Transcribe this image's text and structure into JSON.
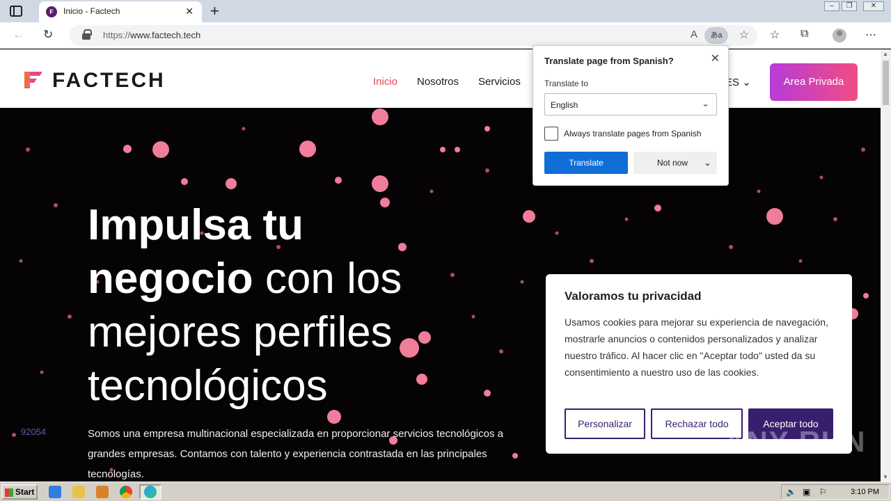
{
  "browser": {
    "tab_title": "Inicio - Factech",
    "url_scheme": "https://",
    "url_host": "www.factech.tech",
    "translate_btn_label": "あa"
  },
  "site": {
    "logo_text": "FACTECH",
    "menu": [
      "Inicio",
      "Nosotros",
      "Servicios"
    ],
    "lang": "ES",
    "area_button": "Area Privada",
    "hero_title_l1": "Impulsa tu",
    "hero_title_l2a": "negocio",
    "hero_title_l2b": " con los",
    "hero_title_l3": "mejores perfiles",
    "hero_title_l4": "tecnológicos",
    "hero_text": "Somos una empresa multinacional especializada en proporcionar servicios tecnológicos a grandes empresas. Contamos con talento y experiencia contrastada en las principales tecnologías.",
    "counter": "92054"
  },
  "cookie": {
    "title": "Valoramos tu privacidad",
    "body": "Usamos cookies para mejorar su experiencia de navegación, mostrarle anuncios o contenidos personalizados y analizar nuestro tráfico. Al hacer clic en \"Aceptar todo\" usted da su consentimiento a nuestro uso de las cookies.",
    "btn_customize": "Personalizar",
    "btn_reject": "Rechazar todo",
    "btn_accept": "Aceptar todo"
  },
  "translate": {
    "title": "Translate page from Spanish?",
    "label": "Translate to",
    "selected_language": "English",
    "always_label": "Always translate pages from Spanish",
    "translate_button": "Translate",
    "not_now_button": "Not now"
  },
  "watermark": "ANY RUN",
  "taskbar": {
    "start_label": "Start",
    "clock": "3:10 PM"
  },
  "colors": {
    "accent_red": "#e8474f",
    "translate_blue": "#0f6fd6",
    "cookie_purple": "#3a1e6e"
  }
}
